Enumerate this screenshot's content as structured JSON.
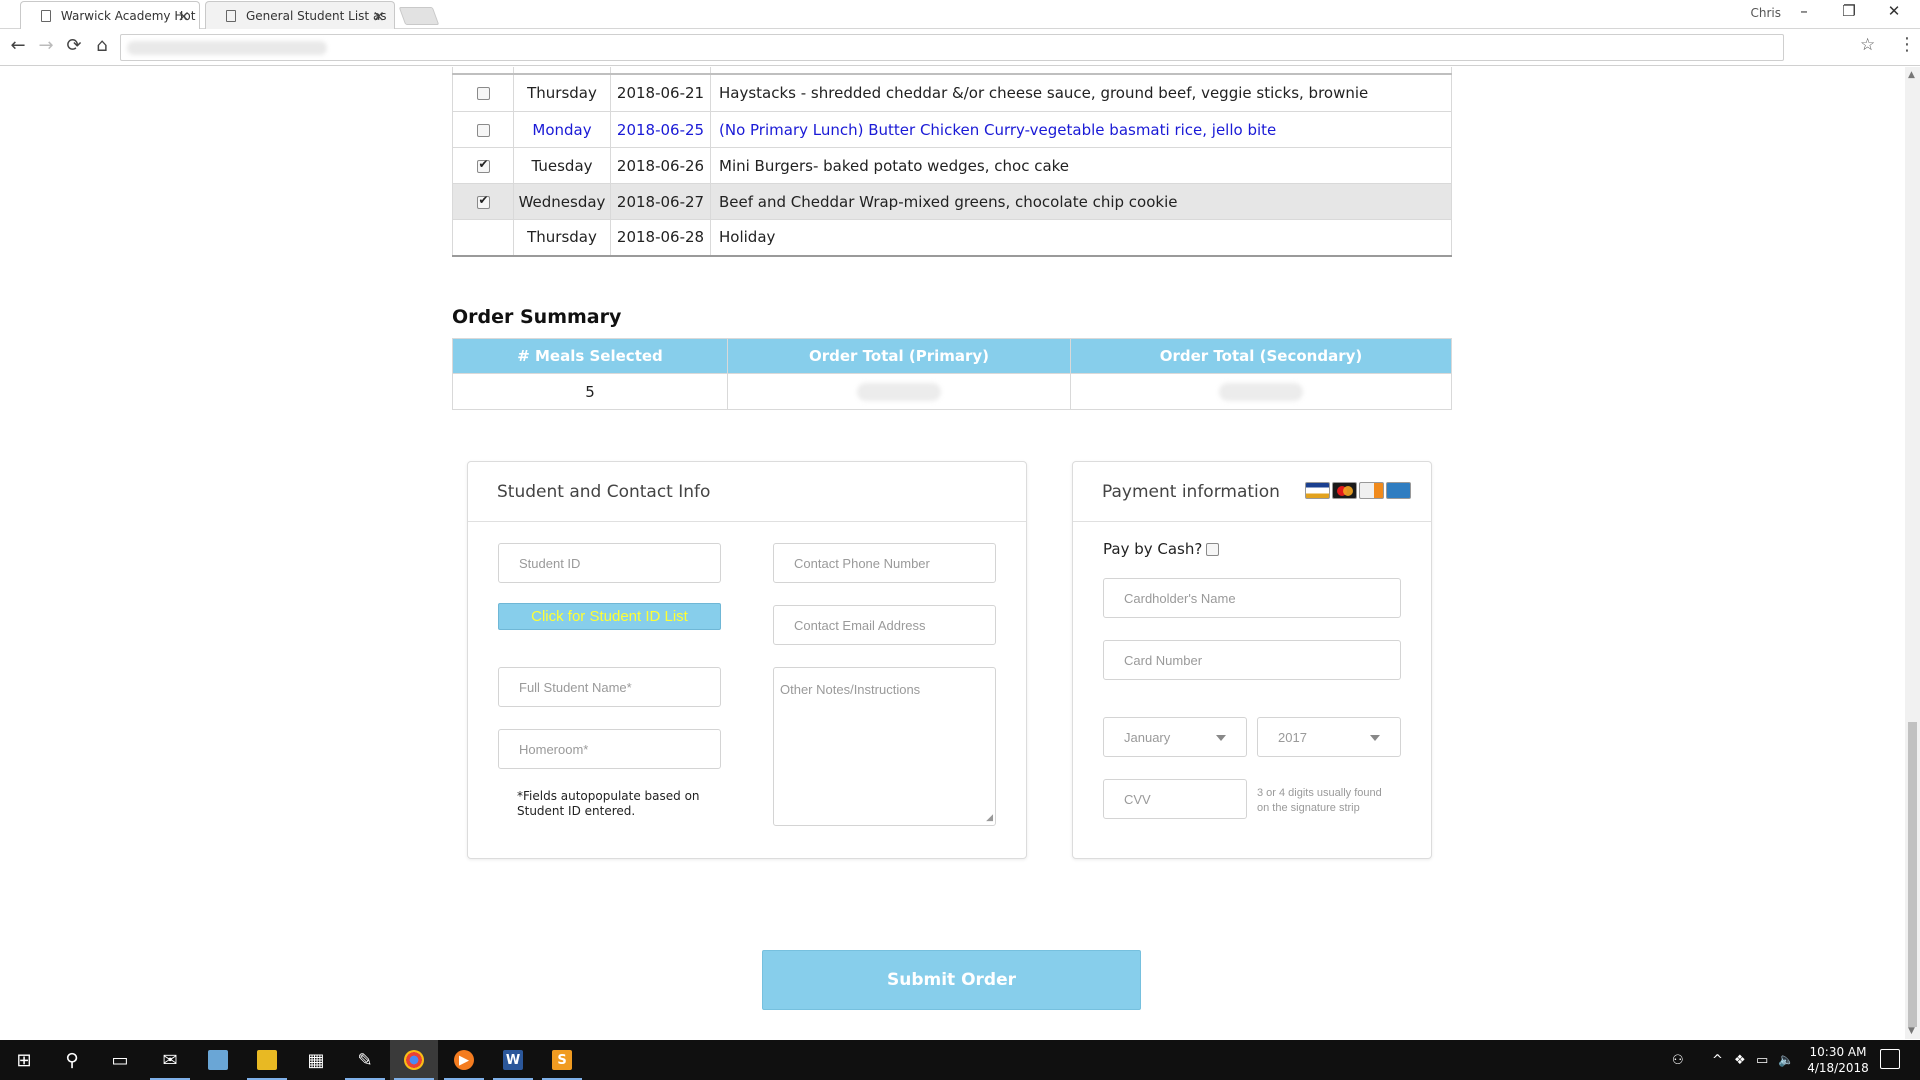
{
  "browser": {
    "tabs": [
      {
        "title": "Warwick Academy Hot Lu",
        "active": true
      },
      {
        "title": "General Student List as o",
        "active": false
      }
    ],
    "profile": "Chris",
    "window_controls": {
      "minimize": "–",
      "restore": "❐",
      "close": "✕"
    }
  },
  "meals": [
    {
      "checked": false,
      "has_checkbox": true,
      "day": "Thursday",
      "date": "2018-06-21",
      "desc": "Haystacks - shredded cheddar &/or cheese sauce, ground beef, veggie sticks, brownie",
      "style": "normal"
    },
    {
      "checked": false,
      "has_checkbox": true,
      "day": "Monday",
      "date": "2018-06-25",
      "desc": "(No Primary Lunch) Butter Chicken Curry-vegetable basmati rice, jello bite",
      "style": "blue"
    },
    {
      "checked": true,
      "has_checkbox": true,
      "day": "Tuesday",
      "date": "2018-06-26",
      "desc": "Mini Burgers- baked potato wedges, choc cake",
      "style": "normal"
    },
    {
      "checked": true,
      "has_checkbox": true,
      "day": "Wednesday",
      "date": "2018-06-27",
      "desc": "Beef and Cheddar Wrap-mixed greens, chocolate chip cookie",
      "style": "grey"
    },
    {
      "checked": false,
      "has_checkbox": false,
      "day": "Thursday",
      "date": "2018-06-28",
      "desc": "Holiday",
      "style": "normal"
    }
  ],
  "summary": {
    "title": "Order Summary",
    "headers": [
      "# Meals Selected",
      "Order Total (Primary)",
      "Order Total (Secondary)"
    ],
    "meals_selected": "5"
  },
  "student": {
    "heading": "Student and Contact Info",
    "student_id_placeholder": "Student ID",
    "id_list_button": "Click for Student ID List",
    "full_name_placeholder": "Full Student Name*",
    "homeroom_placeholder": "Homeroom*",
    "autopop_note_line1": "*Fields autopopulate based on",
    "autopop_note_line2": "Student ID entered.",
    "phone_placeholder": "Contact Phone Number",
    "email_placeholder": "Contact Email Address",
    "notes_placeholder": "Other Notes/Instructions"
  },
  "payment": {
    "heading": "Payment information",
    "card_icons": [
      "visa-card-icon",
      "mastercard-icon",
      "discover-card-icon",
      "amex-card-icon"
    ],
    "pay_by_cash_label": "Pay by Cash?",
    "cardholder_placeholder": "Cardholder's Name",
    "card_number_placeholder": "Card Number",
    "month_value": "January",
    "year_value": "2017",
    "cvv_placeholder": "CVV",
    "cvv_hint_line1": "3 or 4 digits usually found",
    "cvv_hint_line2": "on the signature strip"
  },
  "submit_label": "Submit Order",
  "taskbar": {
    "time": "10:30 AM",
    "date": "4/18/2018"
  },
  "colors": {
    "accent": "#87ceeb",
    "id_button_text": "#ffff33",
    "link_blue": "#1a1ad6",
    "taskbar": "#101010"
  }
}
